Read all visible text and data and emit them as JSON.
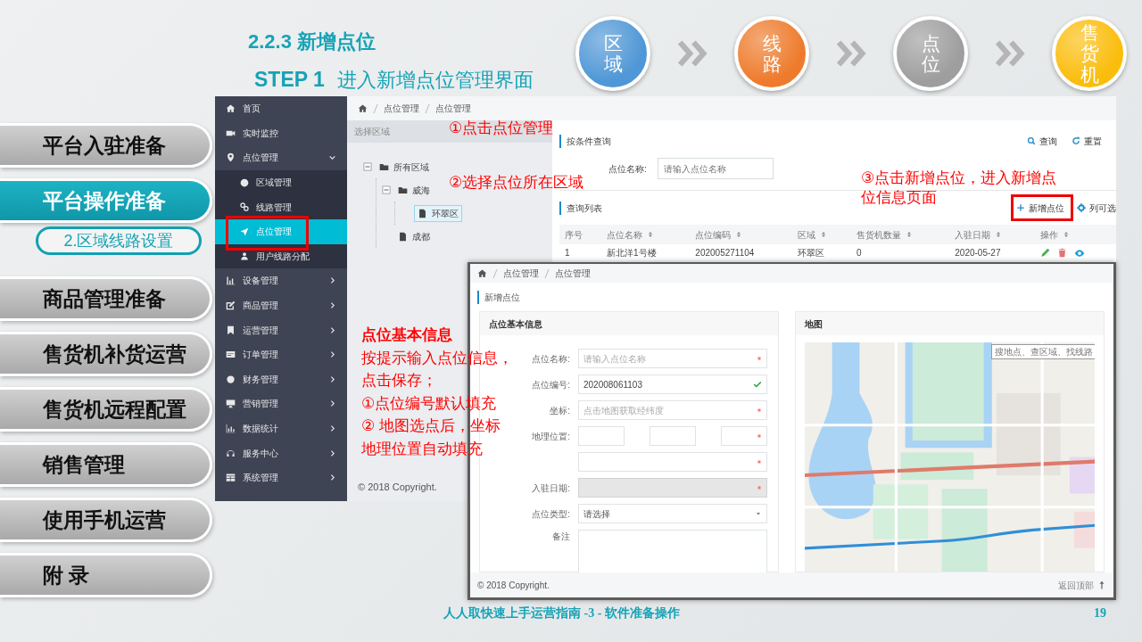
{
  "title": "2.2.3 新增点位",
  "step": {
    "label": "STEP 1",
    "text": "进入新增点位管理界面"
  },
  "process": [
    {
      "label": "区域",
      "color": "#4f97d6"
    },
    {
      "label": "线路",
      "color": "#ee7b2c"
    },
    {
      "label": "点位",
      "color": "#9e9e9e"
    },
    {
      "label": "售货机",
      "color": "#fbbd0c"
    }
  ],
  "chapters": [
    {
      "label": "平台入驻准备",
      "selected": false
    },
    {
      "label": "平台操作准备",
      "selected": true,
      "children": [
        {
          "label": "2.区域线路设置",
          "selected": true
        }
      ]
    },
    {
      "label": "商品管理准备",
      "selected": false
    },
    {
      "label": "售货机补货运营",
      "selected": false
    },
    {
      "label": "售货机远程配置",
      "selected": false
    },
    {
      "label": "销售管理",
      "selected": false
    },
    {
      "label": "使用手机运营",
      "selected": false
    },
    {
      "label": "附 录",
      "selected": false
    }
  ],
  "list_screen": {
    "sidebar": {
      "items": [
        {
          "label": "首页",
          "selected": false
        },
        {
          "label": "实时监控",
          "selected": false
        },
        {
          "label": "点位管理",
          "selected": false,
          "expanded": true,
          "children": [
            {
              "label": "区域管理",
              "selected": false
            },
            {
              "label": "线路管理",
              "selected": false
            },
            {
              "label": "点位管理",
              "selected": true
            },
            {
              "label": "用户线路分配",
              "selected": false
            }
          ]
        },
        {
          "label": "设备管理",
          "selected": false,
          "expanded": false
        },
        {
          "label": "商品管理",
          "selected": false,
          "expanded": false
        },
        {
          "label": "运营管理",
          "selected": false,
          "expanded": false
        },
        {
          "label": "订单管理",
          "selected": false,
          "expanded": false
        },
        {
          "label": "财务管理",
          "selected": false,
          "expanded": false
        },
        {
          "label": "营销管理",
          "selected": false,
          "expanded": false
        },
        {
          "label": "数据统计",
          "selected": false,
          "expanded": false
        },
        {
          "label": "服务中心",
          "selected": false,
          "expanded": false
        },
        {
          "label": "系统管理",
          "selected": false,
          "expanded": false
        }
      ]
    },
    "breadcrumb": [
      "点位管理",
      "点位管理"
    ],
    "tree": {
      "title": "选择区域",
      "nodes": [
        {
          "label": "所有区域",
          "expanded": true,
          "selected": false,
          "children": [
            {
              "label": "威海",
              "expanded": true,
              "selected": false,
              "children": [
                {
                  "label": "环翠区",
                  "selected": true
                }
              ]
            },
            {
              "label": "成都",
              "selected": false
            }
          ]
        }
      ]
    },
    "footer": "© 2018 Copyright.",
    "query": {
      "title": "按条件查询",
      "buttons": [
        "查询",
        "重置"
      ],
      "field": {
        "label": "点位名称:",
        "placeholder": "请输入点位名称"
      }
    },
    "list": {
      "title": "查询列表",
      "buttons": [
        "新增点位",
        "列可选"
      ]
    },
    "table": {
      "columns": [
        {
          "label": "序号",
          "sortable": false
        },
        {
          "label": "点位名称",
          "sortable": true
        },
        {
          "label": "点位编码",
          "sortable": true
        },
        {
          "label": "区域",
          "sortable": true
        },
        {
          "label": "售货机数量",
          "sortable": true
        },
        {
          "label": "入驻日期",
          "sortable": true
        },
        {
          "label": "操作",
          "sortable": true
        }
      ],
      "rows": [
        {
          "cells": [
            "1",
            "新北洋1号楼",
            "202005271104",
            "环翠区",
            "0",
            "2020-05-27"
          ]
        }
      ]
    }
  },
  "form_screen": {
    "breadcrumb": [
      "点位管理",
      "点位管理"
    ],
    "title": "新增点位",
    "form": {
      "title": "点位基本信息",
      "fields": [
        {
          "label": "点位名称:",
          "kind": "text",
          "placeholder": "请输入点位名称",
          "required": true,
          "valid": false,
          "disabled": false
        },
        {
          "label": "点位编号:",
          "kind": "text",
          "value": "202008061103",
          "required": false,
          "valid": true,
          "disabled": false
        },
        {
          "label": "坐标:",
          "kind": "text",
          "placeholder": "点击地图获取经纬度",
          "required": true,
          "valid": false,
          "disabled": false
        },
        {
          "label": "地理位置:",
          "kind": "triple",
          "required": true,
          "valid": false,
          "disabled": false
        },
        {
          "kind": "text",
          "required": true,
          "valid": false,
          "disabled": false
        },
        {
          "label": "入驻日期:",
          "kind": "text",
          "required": true,
          "valid": false,
          "disabled": true
        },
        {
          "label": "点位类型:",
          "kind": "select",
          "value": "请选择",
          "disabled": false
        },
        {
          "label": "备注",
          "kind": "textarea",
          "disabled": false
        }
      ]
    },
    "map": {
      "title": "地图",
      "search_placeholder": "搜地点、查区域、找线路"
    },
    "footer": "© 2018 Copyright.",
    "back_to_top": "返回顶部"
  },
  "annotations": {
    "step1": "①点击点位管理",
    "step2": "②选择点位所在区域",
    "step3": [
      "③点击新增点位，进入新增点",
      "位信息页面"
    ],
    "note": {
      "title": "点位基本信息",
      "lines": [
        "按提示输入点位信息，点击保存；",
        "①点位编号默认填充",
        "② 地图选点后，坐标地理位置自动填充"
      ]
    }
  },
  "slide_footer": {
    "text": "人人取快速上手运营指南 -3 - 软件准备操作",
    "page": "19"
  }
}
